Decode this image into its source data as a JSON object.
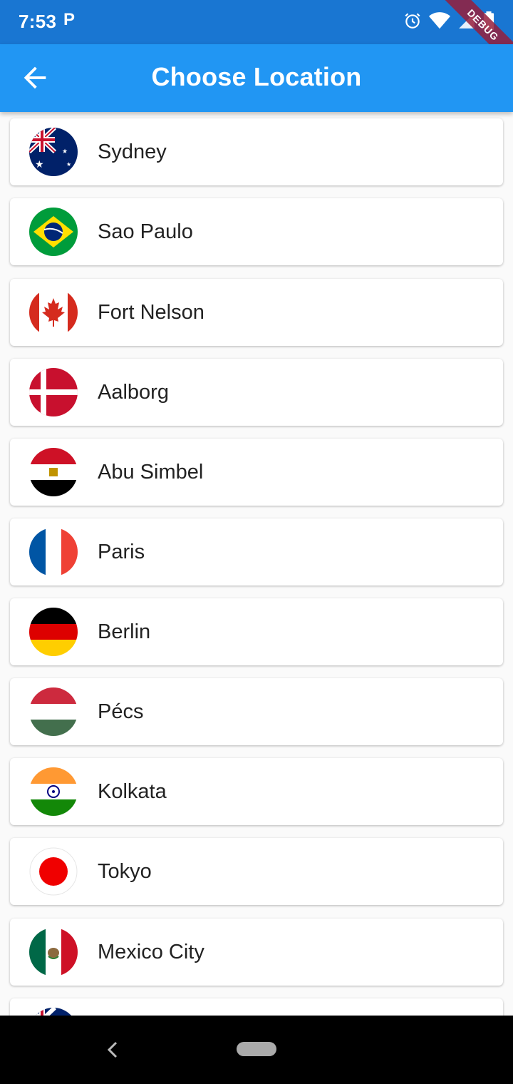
{
  "status_bar": {
    "time": "7:53",
    "notification_glyph": "P",
    "debug_banner": "DEBUG"
  },
  "app_bar": {
    "title": "Choose Location",
    "back_icon": "arrow-back-icon"
  },
  "locations": [
    {
      "city": "Sydney",
      "flag": "australia-flag-icon"
    },
    {
      "city": "Sao Paulo",
      "flag": "brazil-flag-icon"
    },
    {
      "city": "Fort Nelson",
      "flag": "canada-flag-icon"
    },
    {
      "city": "Aalborg",
      "flag": "denmark-flag-icon"
    },
    {
      "city": "Abu Simbel",
      "flag": "egypt-flag-icon"
    },
    {
      "city": "Paris",
      "flag": "france-flag-icon"
    },
    {
      "city": "Berlin",
      "flag": "germany-flag-icon"
    },
    {
      "city": "Pécs",
      "flag": "hungary-flag-icon"
    },
    {
      "city": "Kolkata",
      "flag": "india-flag-icon"
    },
    {
      "city": "Tokyo",
      "flag": "japan-flag-icon"
    },
    {
      "city": "Mexico City",
      "flag": "mexico-flag-icon"
    },
    {
      "city": "",
      "flag": "new-zealand-flag-icon"
    }
  ],
  "colors": {
    "status_bar": "#1976d2",
    "app_bar": "#2196f3",
    "background": "#fafafa"
  }
}
